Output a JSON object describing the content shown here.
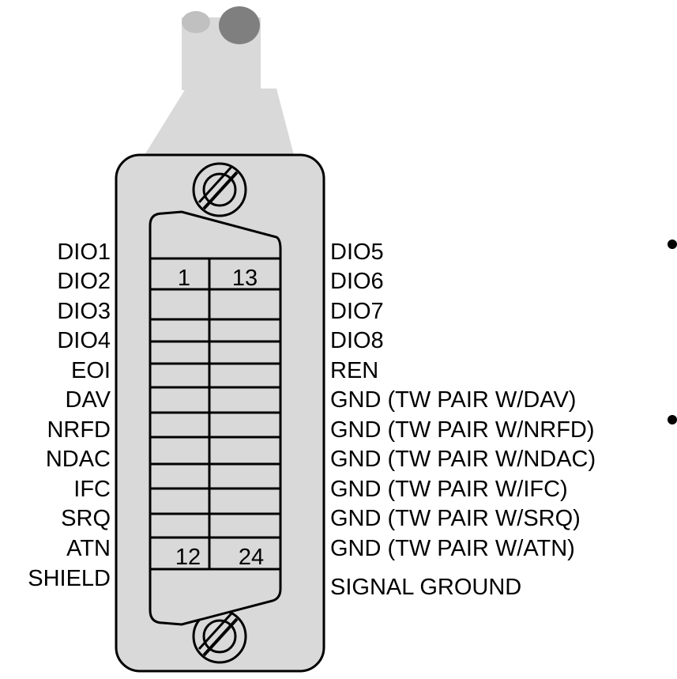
{
  "connector": {
    "left_pins": [
      "DIO1",
      "DIO2",
      "DIO3",
      "DIO4",
      "EOI",
      "DAV",
      "NRFD",
      "NDAC",
      "IFC",
      "SRQ",
      "ATN",
      "SHIELD"
    ],
    "right_pins": [
      "DIO5",
      "DIO6",
      "DIO7",
      "DIO8",
      "REN",
      "GND (TW PAIR W/DAV)",
      "GND (TW PAIR W/NRFD)",
      "GND (TW PAIR W/NDAC)",
      "GND (TW PAIR W/IFC)",
      "GND (TW PAIR W/SRQ)",
      "GND (TW PAIR W/ATN)",
      "SIGNAL GROUND"
    ],
    "pin_numbers": {
      "top_left": "1",
      "top_right": "13",
      "bottom_left": "12",
      "bottom_right": "24"
    },
    "colors": {
      "body": "#d9d9d9",
      "outline": "#000000",
      "cable": "#d9d9d9",
      "cable_tip": "#7f7f7f"
    }
  }
}
